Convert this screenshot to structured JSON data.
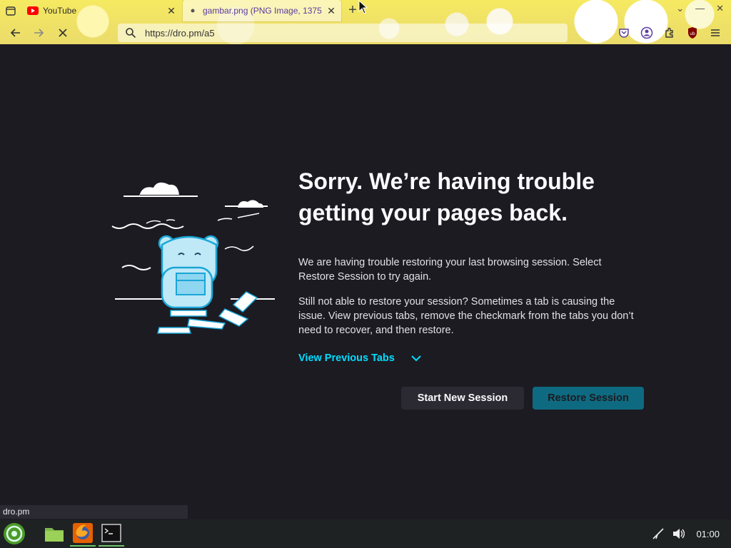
{
  "browser": {
    "tabs": [
      {
        "title": "YouTube",
        "active": false
      },
      {
        "title": "gambar.png (PNG Image, 1375",
        "active": true
      }
    ],
    "new_tab_label": "+",
    "url": "https://dro.pm/a5",
    "extensions": [
      "pocket-icon",
      "account-icon",
      "extensions-icon",
      "ublock-icon",
      "menu-icon"
    ]
  },
  "page": {
    "title": "Sorry. We’re having trouble getting your pages back.",
    "paragraph1": "We are having trouble restoring your last browsing session. Select Restore Session to try again.",
    "paragraph2": "Still not able to restore your session? Sometimes a tab is causing the issue. View previous tabs, remove the checkmark from the tabs you don’t need to recover, and then restore.",
    "view_previous_tabs": "View Previous Tabs",
    "start_new_session": "Start New Session",
    "restore_session": "Restore Session"
  },
  "status_bar": {
    "text": "dro.pm"
  },
  "taskbar": {
    "apps": [
      "opensuse-menu-icon",
      "file-manager-icon",
      "firefox-icon",
      "terminal-icon"
    ],
    "clock": "01:00"
  },
  "colors": {
    "background": "#1c1b22",
    "accent": "#00ddff",
    "restore_button": "#0e6a80",
    "secondary_button": "#2b2a33"
  }
}
